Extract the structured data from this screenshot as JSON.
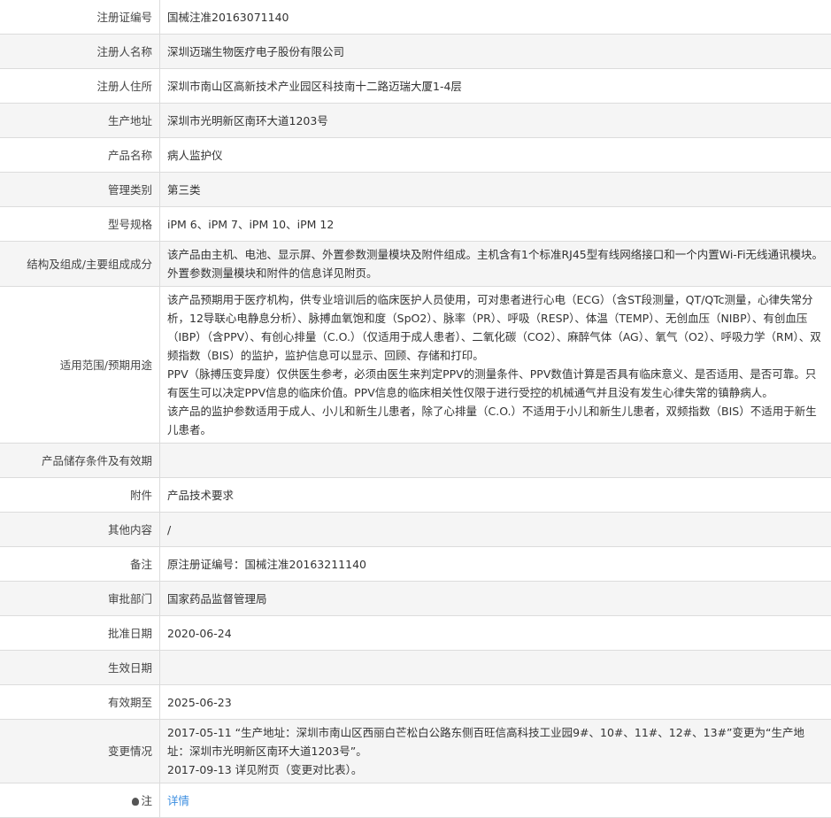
{
  "rows": [
    {
      "label": "注册证编号",
      "value": "国械注准20163071140"
    },
    {
      "label": "注册人名称",
      "value": "深圳迈瑞生物医疗电子股份有限公司"
    },
    {
      "label": "注册人住所",
      "value": "深圳市南山区高新技术产业园区科技南十二路迈瑞大厦1-4层"
    },
    {
      "label": "生产地址",
      "value": "深圳市光明新区南环大道1203号"
    },
    {
      "label": "产品名称",
      "value": "病人监护仪"
    },
    {
      "label": "管理类别",
      "value": "第三类"
    },
    {
      "label": "型号规格",
      "value": "iPM 6、iPM 7、iPM 10、iPM 12"
    },
    {
      "label": "结构及组成/主要组成成分",
      "value": "该产品由主机、电池、显示屏、外置参数测量模块及附件组成。主机含有1个标准RJ45型有线网络接口和一个内置Wi-Fi无线通讯模块。外置参数测量模块和附件的信息详见附页。"
    },
    {
      "label": "适用范围/预期用途",
      "lines": [
        "该产品预期用于医疗机构，供专业培训后的临床医护人员使用，可对患者进行心电（ECG）（含ST段测量，QT/QTc测量，心律失常分析，12导联心电静息分析）、脉搏血氧饱和度（SpO2）、脉率（PR）、呼吸（RESP）、体温（TEMP）、无创血压（NIBP）、有创血压（IBP）（含PPV）、有创心排量（C.O.）（仅适用于成人患者）、二氧化碳（CO2）、麻醉气体（AG）、氧气（O2）、呼吸力学（RM）、双频指数（BIS）的监护，监护信息可以显示、回顾、存储和打印。",
        "PPV（脉搏压变异度）仅供医生参考，必须由医生来判定PPV的测量条件、PPV数值计算是否具有临床意义、是否适用、是否可靠。只有医生可以决定PPV信息的临床价值。PPV信息的临床相关性仅限于进行受控的机械通气并且没有发生心律失常的镇静病人。",
        "该产品的监护参数适用于成人、小儿和新生儿患者，除了心排量（C.O.）不适用于小儿和新生儿患者，双频指数（BIS）不适用于新生儿患者。"
      ]
    },
    {
      "label": "产品储存条件及有效期",
      "value": ""
    },
    {
      "label": "附件",
      "value": "产品技术要求"
    },
    {
      "label": "其他内容",
      "value": "/"
    },
    {
      "label": "备注",
      "value": "原注册证编号：国械注准20163211140"
    },
    {
      "label": "审批部门",
      "value": "国家药品监督管理局"
    },
    {
      "label": "批准日期",
      "value": "2020-06-24"
    },
    {
      "label": "生效日期",
      "value": ""
    },
    {
      "label": "有效期至",
      "value": "2025-06-23"
    },
    {
      "label": "变更情况",
      "lines": [
        "2017-05-11 “生产地址：深圳市南山区西丽白芒松白公路东侧百旺信高科技工业园9#、10#、11#、12#、13#”变更为“生产地址：深圳市光明新区南环大道1203号”。",
        "2017-09-13 详见附页（变更对比表）。"
      ]
    },
    {
      "label": "注",
      "icon": "lightbulb-icon",
      "link": "详情"
    }
  ]
}
